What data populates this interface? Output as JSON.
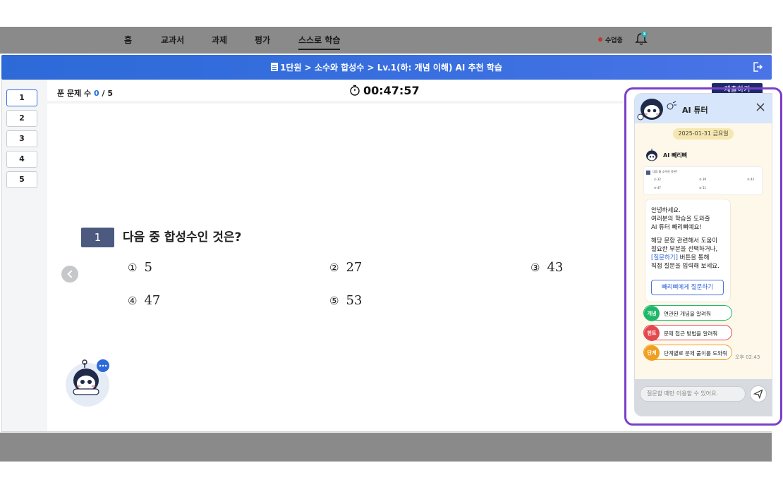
{
  "nav": {
    "items": [
      "홈",
      "교과서",
      "과제",
      "평가",
      "스스로 학습"
    ],
    "active_index": 4,
    "status": "수업중",
    "bell_badge": "3"
  },
  "banner": {
    "title": "1단원 > 소수와 합성수 > Lv.1(하: 개념 이해) AI 추천 학습"
  },
  "sidebar": {
    "questions": [
      "1",
      "2",
      "3",
      "4",
      "5"
    ],
    "active": "1"
  },
  "progress": {
    "label": "푼 문제 수",
    "done": "0",
    "total": "/ 5"
  },
  "timer": "00:47:57",
  "submit_label": "제출하기",
  "question": {
    "number": "1",
    "text": "다음 중 합성수인 것은?",
    "choices": [
      {
        "mark": "①",
        "value": "5"
      },
      {
        "mark": "②",
        "value": "27"
      },
      {
        "mark": "③",
        "value": "43"
      },
      {
        "mark": "④",
        "value": "47"
      },
      {
        "mark": "⑤",
        "value": "53"
      }
    ]
  },
  "tutor": {
    "title": "AI 튜터",
    "date": "2025-01-31 금요일",
    "bot_name": "AI 빼리뼈",
    "mini_question": {
      "text": "다음 중 소수인 것은?",
      "choices": [
        "① 32",
        "② 39",
        "③ 43",
        "④ 47",
        "⑤ 51"
      ]
    },
    "greeting_lines": [
      "안녕하세요.",
      "여러분의 학습을 도와줄",
      "AI 튜터 빼리뼈예요!"
    ],
    "help_lines_a": [
      "해당 문항 관련해서 도움이",
      "필요한 부분을 선택하거나,"
    ],
    "help_link": "[질문하기]",
    "help_link_rest": " 버튼을 통해",
    "help_line_last": "직접 질문을 입력해 보세요.",
    "ask_button": "빼리뼈에게 질문하기",
    "chips": [
      {
        "tag": "개념",
        "text": "연관된 개념을 알려줘",
        "color": "#1fb86a"
      },
      {
        "tag": "힌트",
        "text": "문제 접근 방법을 알려줘",
        "color": "#e4484f"
      },
      {
        "tag": "단계",
        "text": "단계별로 문제 풀이를 도와줘",
        "color": "#f0a020"
      }
    ],
    "timestamp": "오후 02:43",
    "input_placeholder": "질문할 때만 이용할 수 있어요."
  }
}
